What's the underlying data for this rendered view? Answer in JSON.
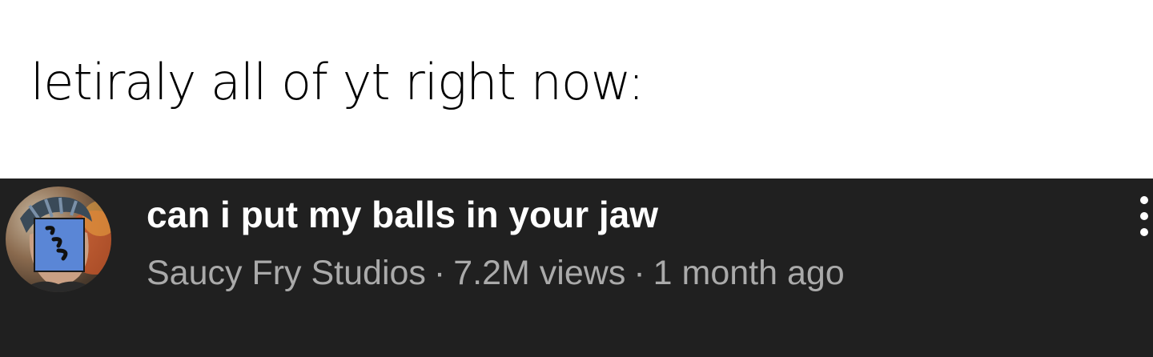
{
  "caption": {
    "text": "letiraly all of yt right now:"
  },
  "video": {
    "title": "can i put my balls in your jaw",
    "channel": "Saucy Fry Studios",
    "separator": "·",
    "views": "7.2M views",
    "age": "1 month ago",
    "channel_avatar_icon": "channel-avatar",
    "menu_icon": "more-vert-icon"
  },
  "colors": {
    "page_background": "#ffffff",
    "row_background": "#202020",
    "title_text": "#ffffff",
    "meta_text": "#aaaaaa",
    "avatar_patch": "#5a86d6"
  }
}
